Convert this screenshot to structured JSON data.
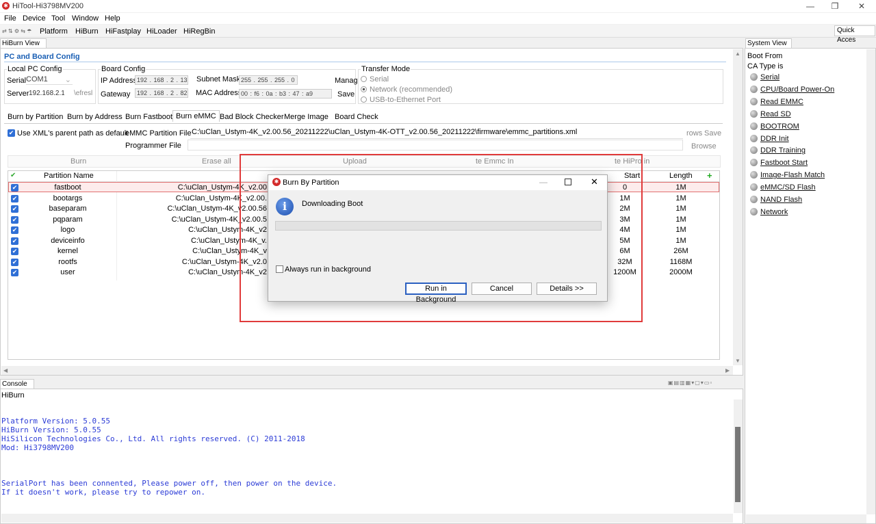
{
  "window": {
    "title": "HiTool-Hi3798MV200",
    "min": "—",
    "max": "❐",
    "close": "✕"
  },
  "menu": [
    "File",
    "Device",
    "Tool",
    "Window",
    "Help"
  ],
  "toolbar": {
    "platform": "Platform",
    "hiburn": "HiBurn",
    "hifastplay": "HiFastplay",
    "hiloader": "HiLoader",
    "hiregbin": "HiRegBin",
    "quick_access": "Quick Acces"
  },
  "view_tab": "HiBurn View",
  "section_title": "PC and Board Config",
  "local_pc": {
    "title": "Local PC Config",
    "serial_label": "Serial",
    "serial_value": "COM1",
    "server_label": "Server",
    "server_value": "192.168.2.1:",
    "refresh": "\\efresl"
  },
  "board": {
    "title": "Board Config",
    "ip_label": "IP Address",
    "ip": "192 . 168 . 2 . 13",
    "gateway_label": "Gateway",
    "gateway": "192 . 168 . 2 . 82",
    "subnet_label": "Subnet Mask",
    "subnet": "255 . 255 . 255 . 0",
    "mac_label": "MAC Address",
    "mac": "00 : f6 : 0a : b3 : 47 : a9",
    "manage": "Manag",
    "save": "Save"
  },
  "transfer": {
    "title": "Transfer Mode",
    "serial": "Serial",
    "network": "Network (recommended)",
    "usb": "USB-to-Ethernet Port"
  },
  "tabs": [
    "Burn by Partition",
    "Burn by Address",
    "Burn Fastboot",
    "Burn eMMC",
    "Bad Block Checker",
    "Merge Image",
    "Board Check"
  ],
  "emmc": {
    "use_xml": "Use XML's parent path as default",
    "partition_label": "eMMC Partition File",
    "partition_value": "C:\\uClan_Ustym-4K_v2.00.56_20211222\\uClan_Ustym-4K-OTT_v2.00.56_20211222\\firmware\\emmc_partitions.xml",
    "rows": "rows",
    "save": "Save",
    "programmer_label": "Programmer File",
    "browse": "Browse"
  },
  "actions": {
    "burn": "Burn",
    "erase_all": "Erase all",
    "upload": "Upload",
    "emmc": "te Emmc In",
    "hipro": "te HiPro in"
  },
  "table": {
    "headers": {
      "name": "Partition Name",
      "start": "Start",
      "length": "Length",
      "add": "+"
    },
    "rows": [
      {
        "name": "fastboot",
        "file": "C:\\uClan_Ustym-4K_v2.00",
        "start": "0",
        "length": "1M"
      },
      {
        "name": "bootargs",
        "file": "C:\\uClan_Ustym-4K_v2.00.",
        "start": "1M",
        "length": "1M"
      },
      {
        "name": "baseparam",
        "file": "C:\\uClan_Ustym-4K_v2.00.56",
        "start": "2M",
        "length": "1M"
      },
      {
        "name": "pqparam",
        "file": "C:\\uClan_Ustym-4K_v2.00.5",
        "start": "3M",
        "length": "1M"
      },
      {
        "name": "logo",
        "file": "C:\\uClan_Ustym-4K_v2",
        "start": "4M",
        "length": "1M"
      },
      {
        "name": "deviceinfo",
        "file": "C:\\uClan_Ustym-4K_v.",
        "start": "5M",
        "length": "1M"
      },
      {
        "name": "kernel",
        "file": "C:\\uClan_Ustym-4K_v",
        "start": "6M",
        "length": "26M"
      },
      {
        "name": "rootfs",
        "file": "C:\\uClan_Ustym-4K_v2.0",
        "start": "32M",
        "length": "1168M"
      },
      {
        "name": "user",
        "file": "C:\\uClan_Ustym-4K_v2",
        "start": "1200M",
        "length": "2000M"
      }
    ]
  },
  "dialog": {
    "title": "Burn By Partition",
    "message": "Downloading Boot",
    "always_bg": "Always run in background",
    "run_bg": "Run in Background",
    "cancel": "Cancel",
    "details": "Details >>",
    "progress": 0
  },
  "console": {
    "tab": "Console",
    "subtitle": "HiBurn",
    "lines": [
      "Platform Version: 5.0.55",
      "HiBurn Version: 5.0.55",
      "HiSilicon Technologies Co., Ltd. All rights reserved. (C) 2011-2018",
      "Mod: Hi3798MV200",
      "SerialPort has been connented, Please power off, then power on the device.",
      "If it doesn't work, please try to repower on."
    ]
  },
  "system_view": {
    "tab": "System View",
    "boot_from": "Boot From",
    "ca_type": "CA Type is",
    "items": [
      "Serial",
      "CPU/Board Power-On",
      "Read EMMC",
      "Read SD",
      "BOOTROM",
      "DDR Init",
      "DDR Training",
      "Fastboot Start",
      "Image-Flash Match",
      "eMMC/SD Flash",
      "NAND Flash",
      "Network"
    ]
  }
}
